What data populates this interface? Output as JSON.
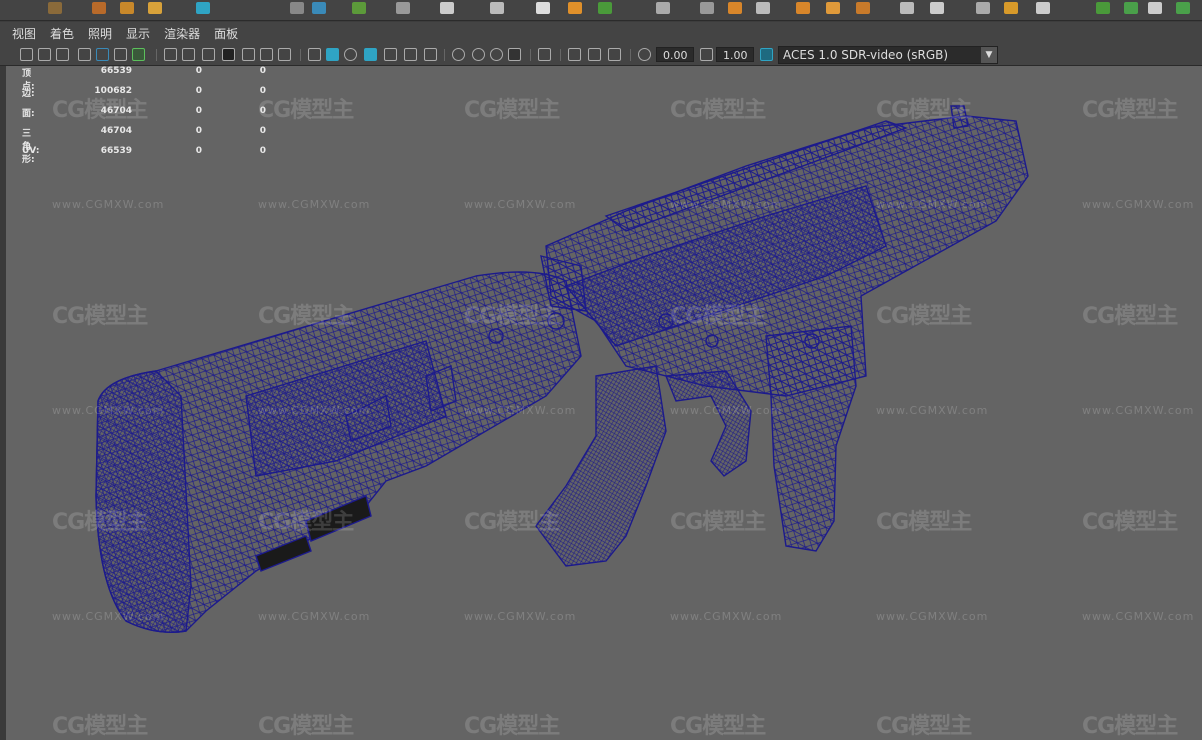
{
  "menu": {
    "items": [
      "视图",
      "着色",
      "照明",
      "显示",
      "渲染器",
      "面板"
    ]
  },
  "toolbar": {
    "exposure_value": "0.00",
    "gamma_value": "1.00",
    "color_space": "ACES 1.0 SDR-video (sRGB)"
  },
  "stats": [
    {
      "label": "顶点:",
      "v1": "66539",
      "v2": "0",
      "v3": "0"
    },
    {
      "label": "边:",
      "v1": "100682",
      "v2": "0",
      "v3": "0"
    },
    {
      "label": "面:",
      "v1": "46704",
      "v2": "0",
      "v3": "0"
    },
    {
      "label": "三角形:",
      "v1": "46704",
      "v2": "0",
      "v3": "0"
    },
    {
      "label": "UV:",
      "v1": "66539",
      "v2": "0",
      "v3": "0"
    }
  ],
  "watermark": {
    "logo": "CG模型主",
    "url": "www.CGMXW.com"
  },
  "colors": {
    "wireframe": "#1c1a8c",
    "viewport_bg": "#646464",
    "accent": "#2fa4c4"
  }
}
